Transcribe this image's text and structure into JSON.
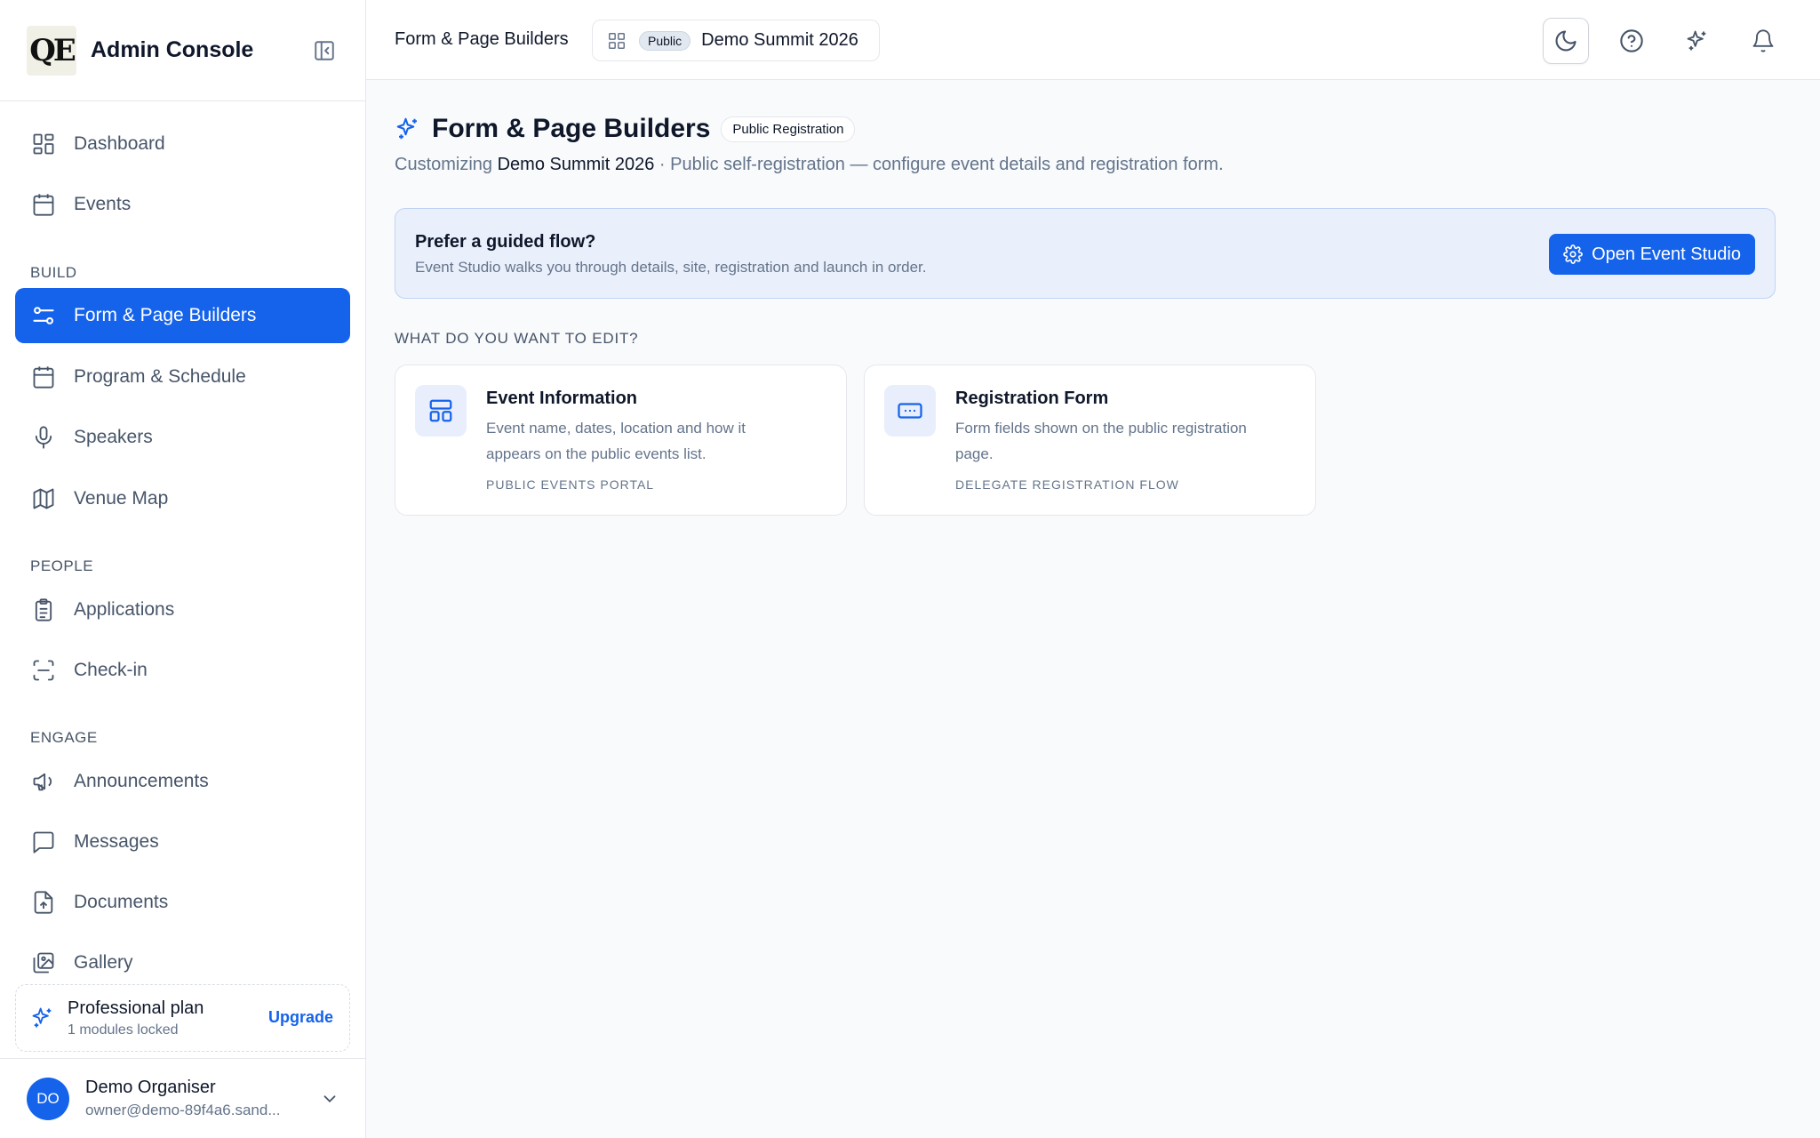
{
  "brand": {
    "logo_text": "QE",
    "title": "Admin Console"
  },
  "nav": {
    "top": [
      {
        "label": "Dashboard",
        "icon": "grid-icon"
      },
      {
        "label": "Events",
        "icon": "calendar-icon"
      }
    ],
    "sections": [
      {
        "title": "BUILD",
        "items": [
          {
            "label": "Form & Page Builders",
            "icon": "sliders-icon",
            "active": true
          },
          {
            "label": "Program & Schedule",
            "icon": "calendar-icon"
          },
          {
            "label": "Speakers",
            "icon": "mic-icon"
          },
          {
            "label": "Venue Map",
            "icon": "map-icon"
          }
        ]
      },
      {
        "title": "PEOPLE",
        "items": [
          {
            "label": "Applications",
            "icon": "clipboard-icon"
          },
          {
            "label": "Check-in",
            "icon": "scan-icon"
          }
        ]
      },
      {
        "title": "ENGAGE",
        "items": [
          {
            "label": "Announcements",
            "icon": "megaphone-icon"
          },
          {
            "label": "Messages",
            "icon": "message-icon"
          },
          {
            "label": "Documents",
            "icon": "file-icon"
          },
          {
            "label": "Gallery",
            "icon": "images-icon"
          }
        ]
      }
    ]
  },
  "plan": {
    "title": "Professional plan",
    "subtitle": "1 modules locked",
    "upgrade": "Upgrade"
  },
  "user": {
    "initials": "DO",
    "name": "Demo Organiser",
    "email": "owner@demo-89f4a6.sand..."
  },
  "header": {
    "breadcrumb": "Form & Page Builders",
    "event_badge": "Public",
    "event_name": "Demo Summit 2026"
  },
  "main": {
    "title": "Form & Page Builders",
    "title_badge": "Public Registration",
    "subtitle_prefix": "Customizing ",
    "subtitle_event": "Demo Summit 2026",
    "subtitle_suffix": " · Public self-registration — configure event details and registration form.",
    "guide": {
      "title": "Prefer a guided flow?",
      "subtitle": "Event Studio walks you through details, site, registration and launch in order.",
      "button": "Open Event Studio"
    },
    "edit_label": "WHAT DO YOU WANT TO EDIT?",
    "cards": [
      {
        "title": "Event Information",
        "desc": "Event name, dates, location and how it appears on the public events list.",
        "tag": "PUBLIC EVENTS PORTAL"
      },
      {
        "title": "Registration Form",
        "desc": "Form fields shown on the public registration page.",
        "tag": "DELEGATE REGISTRATION FLOW"
      }
    ]
  },
  "colors": {
    "accent": "#1563eb",
    "muted": "#64748b",
    "banner_bg": "#eaf0fb"
  }
}
